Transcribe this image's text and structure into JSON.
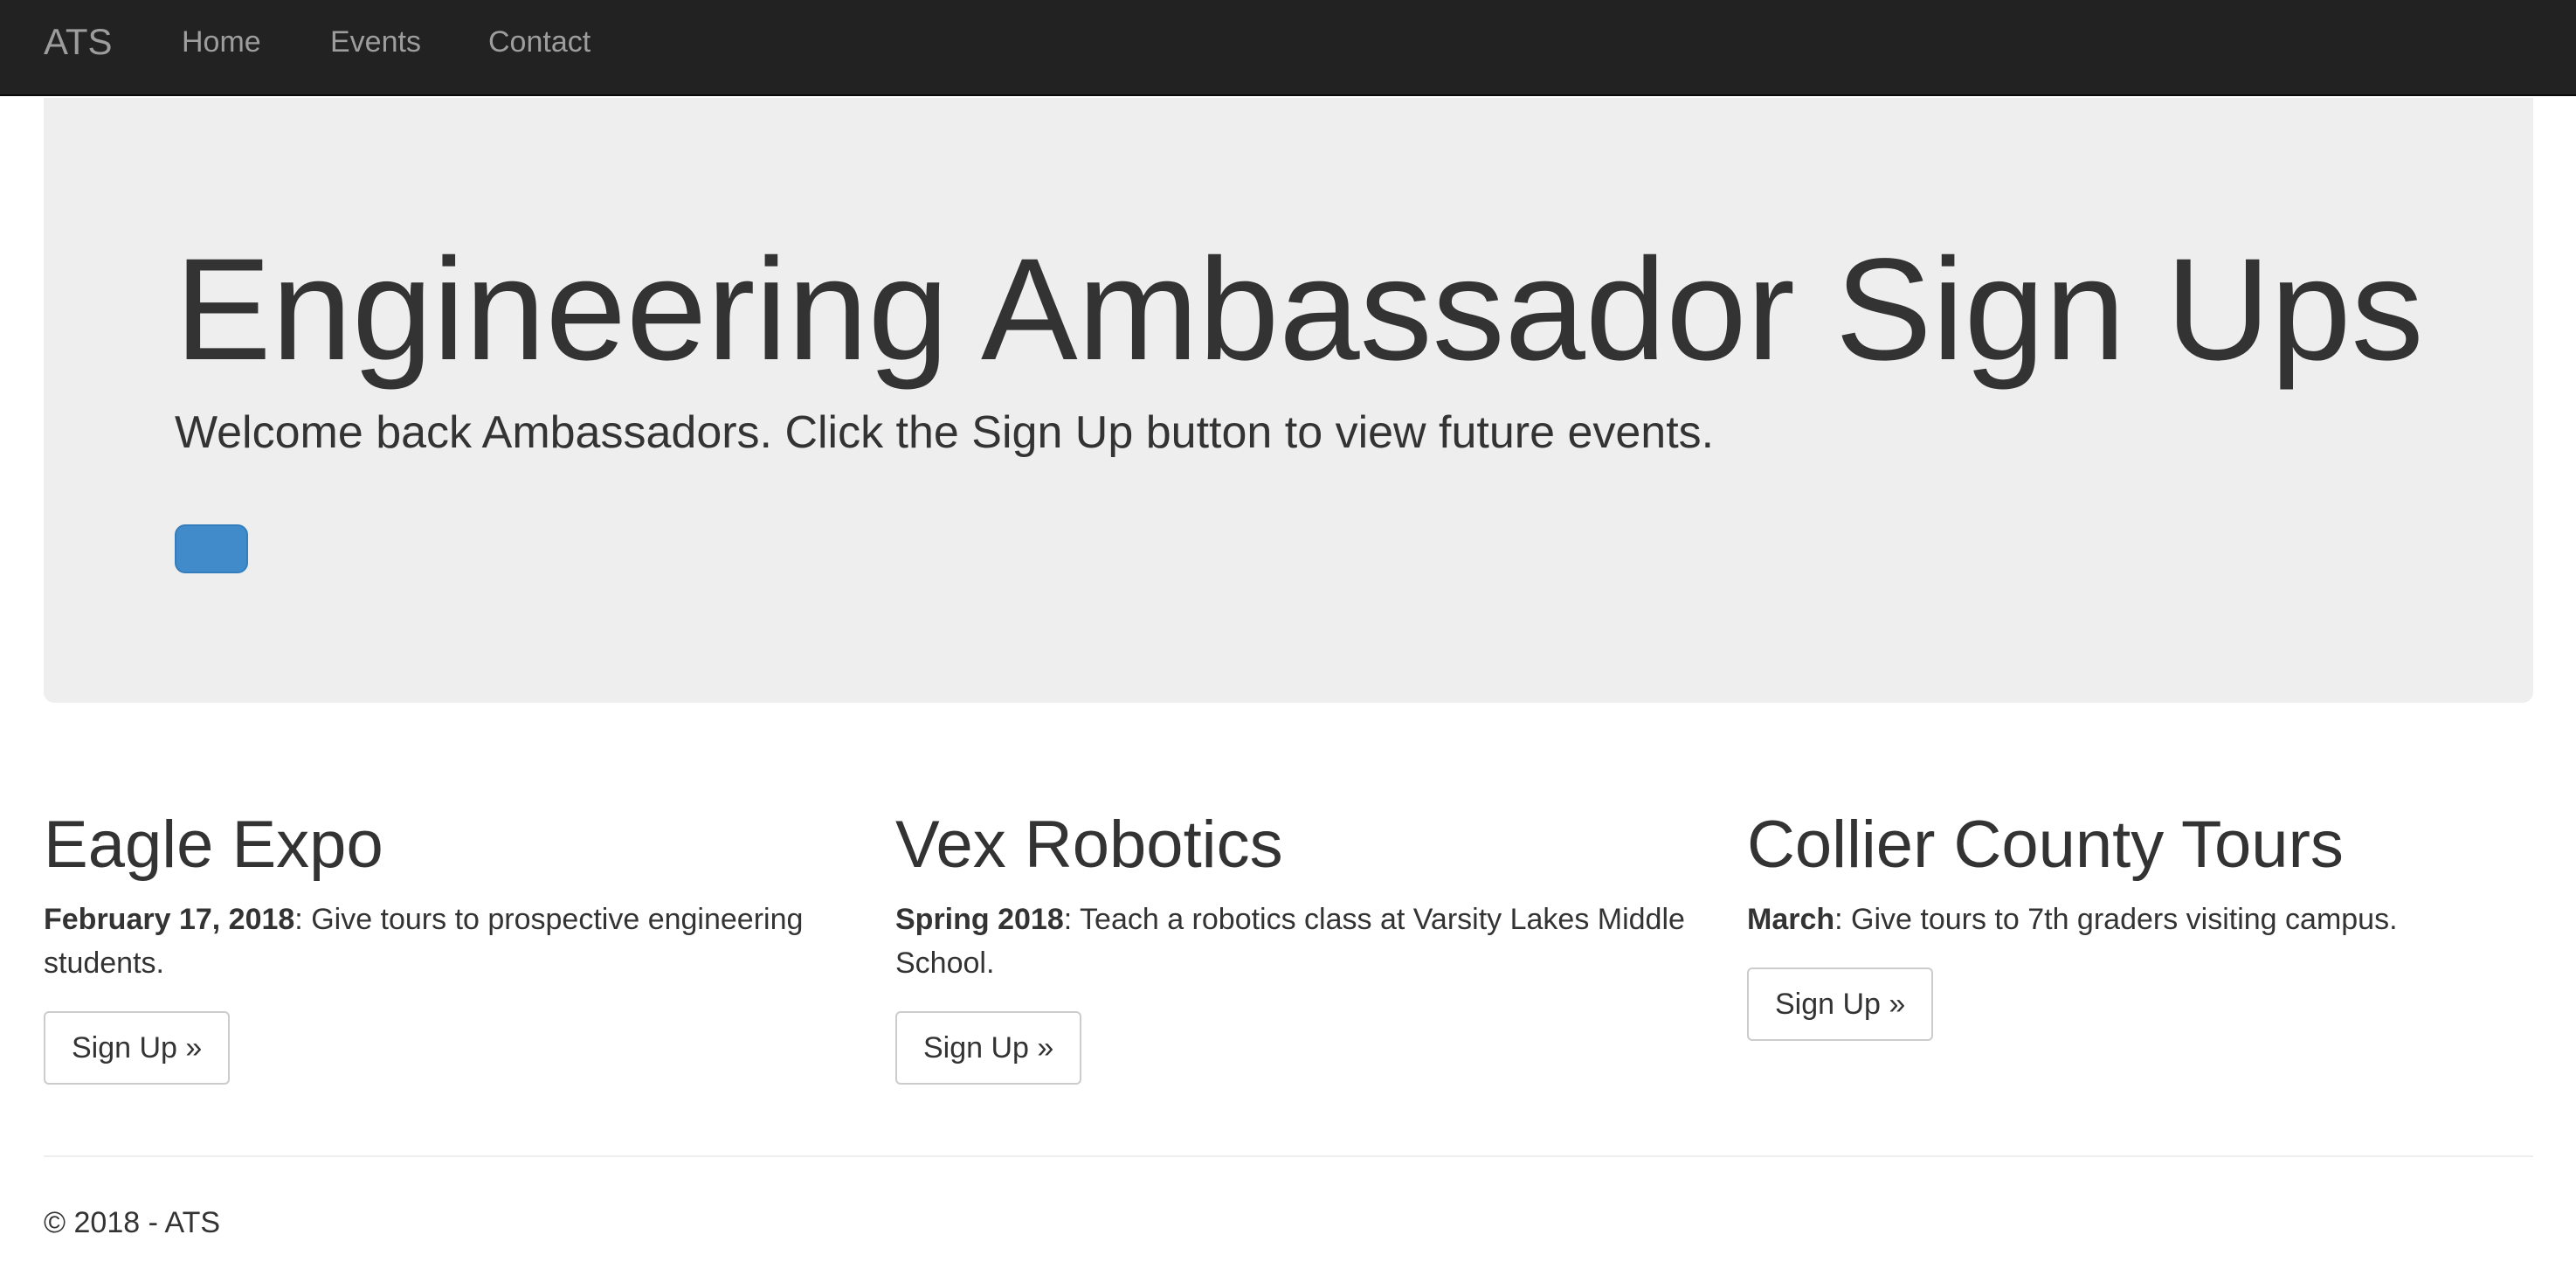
{
  "navbar": {
    "brand": "ATS",
    "links": [
      "Home",
      "Events",
      "Contact"
    ]
  },
  "jumbotron": {
    "title": "Engineering Ambassador Sign Ups",
    "lead": "Welcome back Ambassadors. Click the Sign Up button to view future events.",
    "button_label": ""
  },
  "events": [
    {
      "title": "Eagle Expo",
      "date": "February 17, 2018",
      "description": ": Give tours to prospective engineering students.",
      "button": "Sign Up »"
    },
    {
      "title": "Vex Robotics",
      "date": "Spring 2018",
      "description": ": Teach a robotics class at Varsity Lakes Middle School.",
      "button": "Sign Up »"
    },
    {
      "title": "Collier County Tours",
      "date": "March",
      "description": ": Give tours to 7th graders visiting campus.",
      "button": "Sign Up »"
    }
  ],
  "footer": {
    "text": "© 2018 - ATS"
  },
  "colors": {
    "navbar_bg": "#222222",
    "nav_text": "#9d9d9d",
    "jumbotron_bg": "#eeeeee",
    "primary_button": "#428bca"
  }
}
